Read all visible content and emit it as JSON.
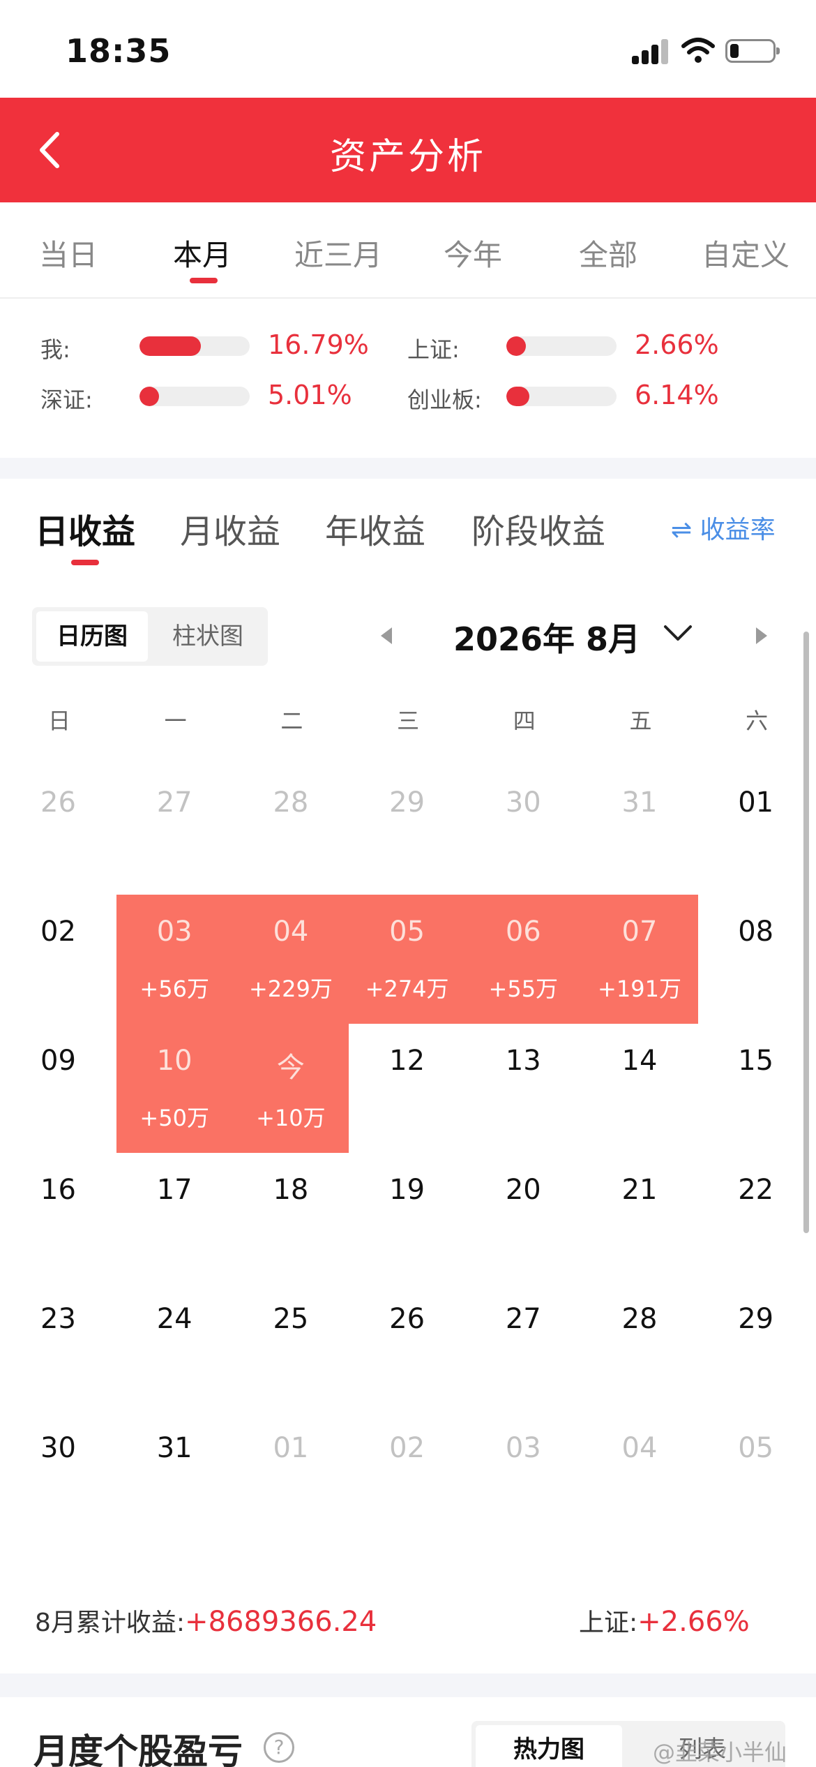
{
  "status_bar": {
    "time": "18:35"
  },
  "header": {
    "title": "资产分析"
  },
  "period_tabs": [
    "当日",
    "本月",
    "近三月",
    "今年",
    "全部",
    "自定义"
  ],
  "comparison": [
    {
      "label": "我:",
      "value": "16.79%",
      "fill": 0.56
    },
    {
      "label": "上证:",
      "value": "2.66%",
      "fill": 0.09
    },
    {
      "label": "深证:",
      "value": "5.01%",
      "fill": 0.17
    },
    {
      "label": "创业板:",
      "value": "6.14%",
      "fill": 0.21
    }
  ],
  "profit_tabs": [
    "日收益",
    "月收益",
    "年收益",
    "阶段收益"
  ],
  "rate_toggle": "⇌ 收益率",
  "view_switch": [
    "日历图",
    "柱状图"
  ],
  "month_title": "2026年 8月",
  "weekdays": [
    "日",
    "一",
    "二",
    "三",
    "四",
    "五",
    "六"
  ],
  "calendar": [
    [
      {
        "d": "26",
        "m": true
      },
      {
        "d": "27",
        "m": true
      },
      {
        "d": "28",
        "m": true
      },
      {
        "d": "29",
        "m": true
      },
      {
        "d": "30",
        "m": true
      },
      {
        "d": "31",
        "m": true
      },
      {
        "d": "01"
      }
    ],
    [
      {
        "d": "02"
      },
      {
        "d": "03",
        "a": "+56万"
      },
      {
        "d": "04",
        "a": "+229万"
      },
      {
        "d": "05",
        "a": "+274万"
      },
      {
        "d": "06",
        "a": "+55万"
      },
      {
        "d": "07",
        "a": "+191万"
      },
      {
        "d": "08"
      }
    ],
    [
      {
        "d": "09"
      },
      {
        "d": "10",
        "a": "+50万"
      },
      {
        "d": "今",
        "a": "+10万"
      },
      {
        "d": "12"
      },
      {
        "d": "13"
      },
      {
        "d": "14"
      },
      {
        "d": "15"
      }
    ],
    [
      {
        "d": "16"
      },
      {
        "d": "17"
      },
      {
        "d": "18"
      },
      {
        "d": "19"
      },
      {
        "d": "20"
      },
      {
        "d": "21"
      },
      {
        "d": "22"
      }
    ],
    [
      {
        "d": "23"
      },
      {
        "d": "24"
      },
      {
        "d": "25"
      },
      {
        "d": "26"
      },
      {
        "d": "27"
      },
      {
        "d": "28"
      },
      {
        "d": "29"
      }
    ],
    [
      {
        "d": "30"
      },
      {
        "d": "31"
      },
      {
        "d": "01",
        "m": true
      },
      {
        "d": "02",
        "m": true
      },
      {
        "d": "03",
        "m": true
      },
      {
        "d": "04",
        "m": true
      },
      {
        "d": "05",
        "m": true
      }
    ]
  ],
  "summary": {
    "left_label": "8月累计收益:",
    "left_value": "+8689366.24",
    "right_label": "上证:",
    "right_value": "+2.66%"
  },
  "bottom": {
    "title": "月度个股盈亏",
    "help": "?",
    "switch": [
      "热力图",
      "列表"
    ],
    "watermark": "@韭菜小半仙"
  },
  "colors": {
    "brand": "#f0313c",
    "profit_cell": "#fa7264",
    "link": "#4a8ee6"
  }
}
